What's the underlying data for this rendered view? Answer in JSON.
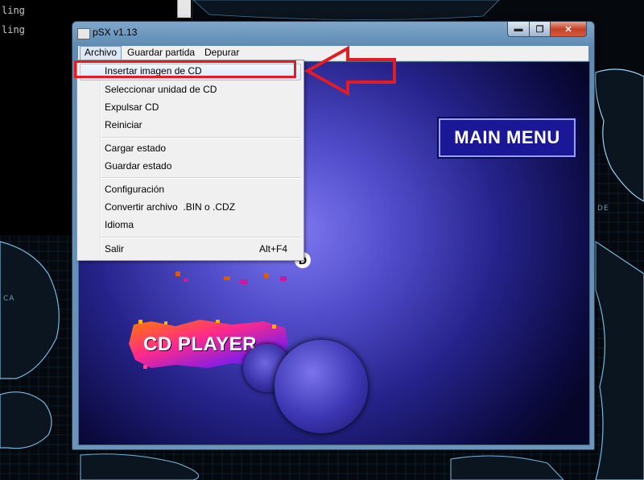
{
  "console": {
    "lines": [
      "ling",
      "ling"
    ]
  },
  "desktop": {
    "label_ca": "CA",
    "label_de": "DE"
  },
  "window": {
    "title": "pSX v1.13",
    "min_glyph": "▬",
    "max_glyph": "❐",
    "close_glyph": "✕"
  },
  "menubar": {
    "items": [
      "Archivo",
      "Guardar partida",
      "Depurar"
    ]
  },
  "dropdown": {
    "group1": [
      "Insertar imagen de CD",
      "Seleccionar unidad de CD",
      "Expulsar CD",
      "Reiniciar"
    ],
    "group2": [
      "Cargar estado",
      "Guardar estado"
    ],
    "group3": [
      "Configuración",
      "Convertir archivo  .BIN o .CDZ",
      "Idioma"
    ],
    "group4": [
      "Salir"
    ],
    "salir_shortcut": "Alt+F4",
    "highlighted_item": "Insertar imagen de CD"
  },
  "screen": {
    "main_menu_label": "MAIN MENU",
    "cd_player_label": "CD PLAYER",
    "partial_label": "D"
  },
  "colors": {
    "annotation_red": "#e21c24",
    "screen_blue": "#4f4bc8"
  }
}
